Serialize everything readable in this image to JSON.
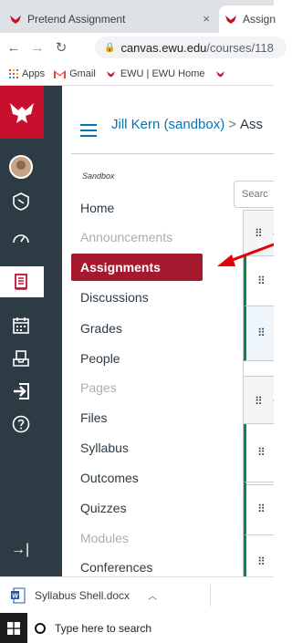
{
  "browser": {
    "tabs": [
      {
        "title": "Pretend Assignment",
        "close": "×"
      },
      {
        "title": "Assign"
      }
    ],
    "url_host": "canvas.ewu.edu",
    "url_path": "/courses/118",
    "bookmarks": [
      "Apps",
      "Gmail",
      "EWU | EWU Home"
    ]
  },
  "header": {
    "course": "Jill Kern (sandbox)",
    "separator": ">",
    "current": "Ass"
  },
  "course_nav": {
    "label": "Sandbox",
    "items": [
      {
        "label": "Home",
        "enabled": true
      },
      {
        "label": "Announcements",
        "enabled": false
      },
      {
        "label": "Assignments",
        "enabled": true,
        "active": true
      },
      {
        "label": "Discussions",
        "enabled": true
      },
      {
        "label": "Grades",
        "enabled": true
      },
      {
        "label": "People",
        "enabled": true
      },
      {
        "label": "Pages",
        "enabled": false
      },
      {
        "label": "Files",
        "enabled": true
      },
      {
        "label": "Syllabus",
        "enabled": true
      },
      {
        "label": "Outcomes",
        "enabled": true
      },
      {
        "label": "Quizzes",
        "enabled": true
      },
      {
        "label": "Modules",
        "enabled": false
      },
      {
        "label": "Conferences",
        "enabled": true
      }
    ]
  },
  "search": {
    "placeholder": "Searc"
  },
  "downloads": {
    "file": "Syllabus Shell.docx"
  },
  "taskbar": {
    "search_placeholder": "Type here to search"
  },
  "colors": {
    "ewu_red": "#c8102e",
    "active_item": "#a4192d",
    "global_nav": "#2d3b45",
    "link": "#0374b5",
    "published": "#0b874b",
    "annotation_arrow": "#e3000b"
  }
}
